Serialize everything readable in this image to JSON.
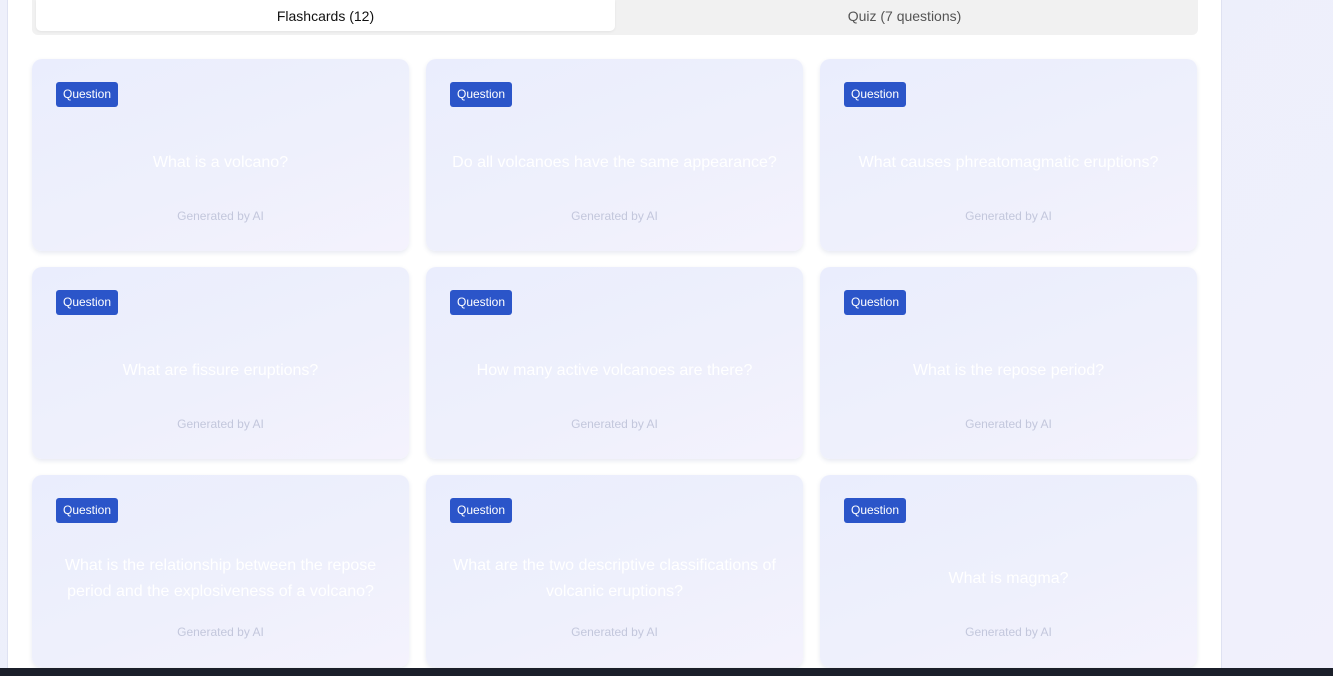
{
  "tabs": [
    {
      "label": "Flashcards (12)",
      "active": true
    },
    {
      "label": "Quiz (7 questions)",
      "active": false
    }
  ],
  "cards": [
    {
      "badge": "Question",
      "text": "What is a volcano?",
      "footer": "Generated by AI"
    },
    {
      "badge": "Question",
      "text": "Do all volcanoes have the same appearance?",
      "footer": "Generated by AI"
    },
    {
      "badge": "Question",
      "text": "What causes phreatomagmatic eruptions?",
      "footer": "Generated by AI"
    },
    {
      "badge": "Question",
      "text": "What are fissure eruptions?",
      "footer": "Generated by AI"
    },
    {
      "badge": "Question",
      "text": "How many active volcanoes are there?",
      "footer": "Generated by AI"
    },
    {
      "badge": "Question",
      "text": "What is the repose period?",
      "footer": "Generated by AI"
    },
    {
      "badge": "Question",
      "text": "What is the relationship between the repose period and the explosiveness of a volcano?",
      "footer": "Generated by AI"
    },
    {
      "badge": "Question",
      "text": "What are the two descriptive classifications of volcanic eruptions?",
      "footer": "Generated by AI"
    },
    {
      "badge": "Question",
      "text": "What is magma?",
      "footer": "Generated by AI"
    }
  ],
  "colors": {
    "badge": "#2b55c9",
    "card_start": "#eaedfd",
    "card_end": "#f4f2fd",
    "bottom_bar": "#1b1f2a"
  }
}
